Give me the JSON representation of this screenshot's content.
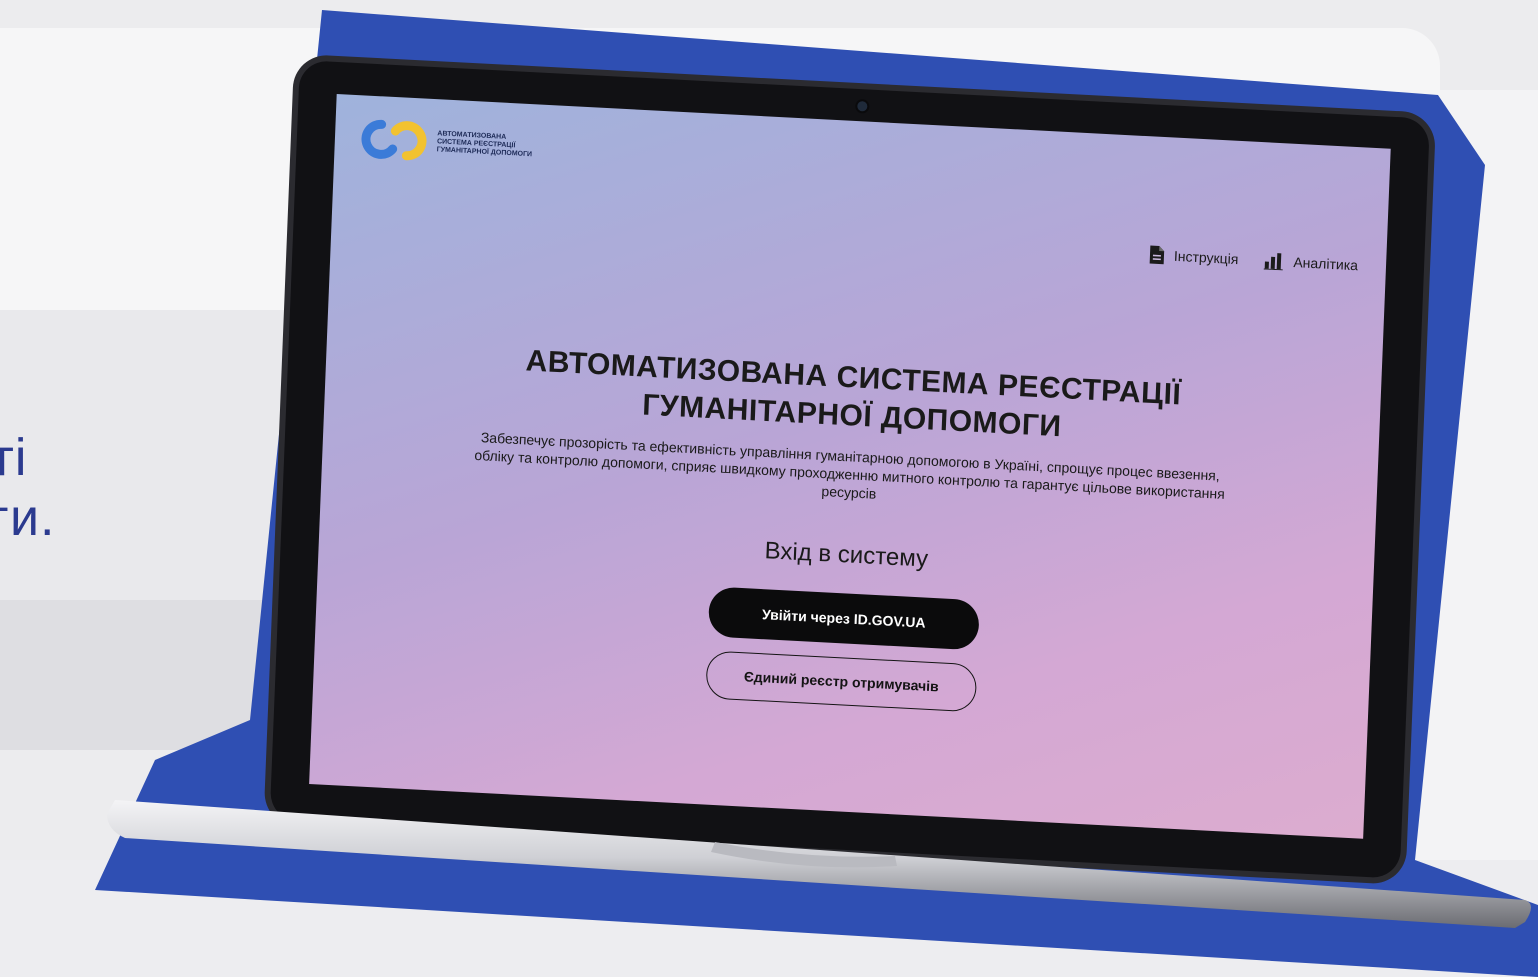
{
  "page": {
    "side_text_line1": "ті",
    "side_text_line2": "ги."
  },
  "colors": {
    "accent_blue": "#2f4fb3",
    "brand_dark": "#1d2a57",
    "logo_blue": "#3b7bd8",
    "logo_yellow": "#f2c230",
    "button_dark": "#0b0b0c"
  },
  "screen": {
    "logo": {
      "line1": "АВТОМАТИЗОВАНА",
      "line2": "СИСТЕМА РЕЄСТРАЦІЇ",
      "line3": "ГУМАНІТАРНОЇ ДОПОМОГИ",
      "icon": "interlocking-rings-icon"
    },
    "nav": {
      "instructions_label": "Інструкція",
      "instructions_icon": "document-icon",
      "analytics_label": "Аналітика",
      "analytics_icon": "bar-chart-icon"
    },
    "hero": {
      "title_line1": "АВТОМАТИЗОВАНА СИСТЕМА РЕЄСТРАЦІЇ",
      "title_line2": "ГУМАНІТАРНОЇ ДОПОМОГИ",
      "description": "Забезпечує прозорість та ефективність управління гуманітарною допомогою в Україні, спрощує процес ввезення, обліку та контролю допомоги, сприяє швидкому проходженню митного контролю та гарантує цільове використання ресурсів"
    },
    "login": {
      "title": "Вхід в систему",
      "primary_button": "Увійти через ID.GOV.UA",
      "secondary_button": "Єдиний реєстр отримувачів"
    }
  }
}
